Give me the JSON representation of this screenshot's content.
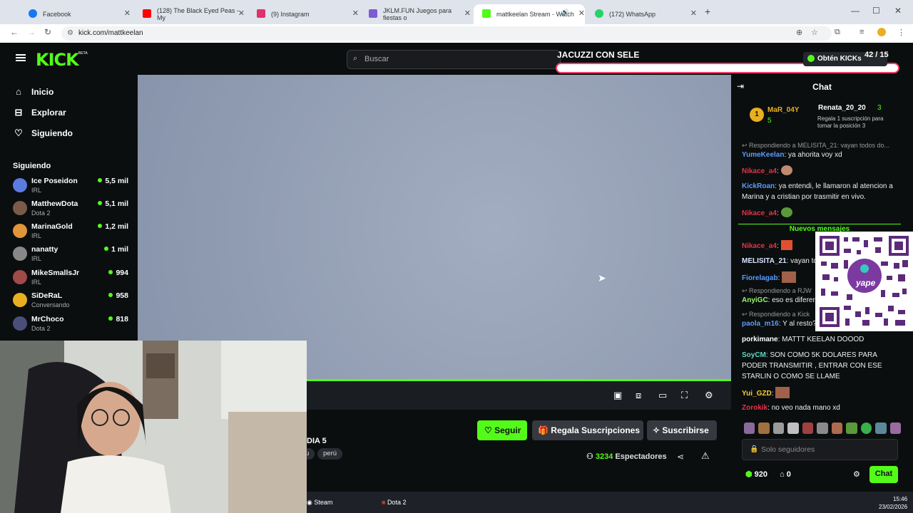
{
  "browser": {
    "tabs": [
      {
        "label": "Facebook",
        "color": "#1877f2"
      },
      {
        "label": "(128) The Black Eyed Peas - My",
        "color": "#ff0000"
      },
      {
        "label": "(9) Instagram",
        "color": "#e1306c"
      },
      {
        "label": "JKLM.FUN Juegos para fiestas o",
        "color": "#7b5cd6"
      },
      {
        "label": "mattkeelan Stream - Watch",
        "color": "#53fc18"
      },
      {
        "label": "(172) WhatsApp",
        "color": "#25d366"
      }
    ],
    "url": "kick.com/mattkeelan"
  },
  "header": {
    "logo": "KICK",
    "beta": "BETA",
    "search_placeholder": "Buscar",
    "overlay_title": "JACUZZI CON SELE",
    "get_kicks": "Obtén KICKs",
    "counter": "42 / 15"
  },
  "sidebar": {
    "nav": [
      {
        "label": "Inicio",
        "icon": "home-icon"
      },
      {
        "label": "Explorar",
        "icon": "compass-icon"
      },
      {
        "label": "Siguiendo",
        "icon": "heart-icon"
      }
    ],
    "section_title": "Siguiendo",
    "following": [
      {
        "name": "Ice Poseidon",
        "category": "IRL",
        "viewers": "5,5 mil",
        "color": "#5b7be0"
      },
      {
        "name": "MatthewDota",
        "category": "Dota 2",
        "viewers": "5,1 mil",
        "color": "#7a5b4a"
      },
      {
        "name": "MarinaGold",
        "category": "IRL",
        "viewers": "1,2 mil",
        "color": "#e0953a"
      },
      {
        "name": "nanatty",
        "category": "IRL",
        "viewers": "1 mil",
        "color": "#888888"
      },
      {
        "name": "MikeSmallsJr",
        "category": "IRL",
        "viewers": "994",
        "color": "#a04a4a"
      },
      {
        "name": "SiDeRaL",
        "category": "Conversando",
        "viewers": "958",
        "color": "#e8b020"
      },
      {
        "name": "MrChoco",
        "category": "Dota 2",
        "viewers": "818",
        "color": "#4a4f7a"
      }
    ]
  },
  "stream": {
    "title_fragment": "DIA 5",
    "tags": [
      "u",
      "perú"
    ],
    "follow_label": "Seguir",
    "gift_label": "Regala Suscripciones",
    "subscribe_label": "Suscribirse",
    "viewers_count": "3234",
    "viewers_label": "Espectadores"
  },
  "chat": {
    "title": "Chat",
    "leader1": {
      "name": "MaR_04Y",
      "rank": "1",
      "count": "5"
    },
    "leader2": {
      "name": "Renata_20_20",
      "count": "3",
      "note": "Regala 1 suscripción para tomar la posición 3"
    },
    "messages": [
      {
        "type": "reply",
        "text": "Respondiendo a MELISITA_21: vayan todos do..."
      },
      {
        "user": "YumeKeelan",
        "color": "#5b9cff",
        "text": "ya ahorita voy xd"
      },
      {
        "user": "Nikace_a4",
        "color": "#e2334b",
        "text": ""
      },
      {
        "user": "KickRoan",
        "color": "#5b9cff",
        "text": "ya entendi, le llamaron al atencion a Marina y a cristian por trasmitir en vivo."
      },
      {
        "user": "Nikace_a4",
        "color": "#e2334b",
        "text": ""
      },
      {
        "user": "Nikace_a4",
        "color": "#e2334b",
        "text": ""
      },
      {
        "user": "MELISITA_21",
        "color": "#d9e6ff",
        "text": "vayan to"
      },
      {
        "user": "Fiorelagab",
        "color": "#5b9cff",
        "text": ""
      },
      {
        "type": "reply",
        "text": "Respondiendo a RJW"
      },
      {
        "user": "AnyiGC",
        "color": "#9bf86b",
        "text": "eso es diferer"
      },
      {
        "type": "reply",
        "text": "Respondiendo a Kick"
      },
      {
        "user": "paola_m16",
        "color": "#5b9cff",
        "text": "Y al resto?"
      },
      {
        "user": "porkimane",
        "color": "#ffffff",
        "text": "MATTT KEELAN DOOOD"
      },
      {
        "user": "SoyCM",
        "color": "#5bd9c4",
        "text": "SON COMO 5K DOLARES PARA PODER TRANSMITIR , ENTRAR CON ESE STARLIN O COMO SE LLAME"
      },
      {
        "user": "Yui_GZD",
        "color": "#ffcc33",
        "text": ""
      },
      {
        "user": "Zorokik",
        "color": "#e2334b",
        "text": "no veo nada mano xd"
      }
    ],
    "new_messages": "Nuevos mensajes",
    "qr_label": "yape",
    "input_placeholder": "Solo seguidores",
    "points": "920",
    "gifts": "0",
    "chat_button": "Chat"
  },
  "taskbar": {
    "steam": "Steam",
    "dota": "Dota 2",
    "time": "15:46",
    "date": "23/02/2026"
  }
}
